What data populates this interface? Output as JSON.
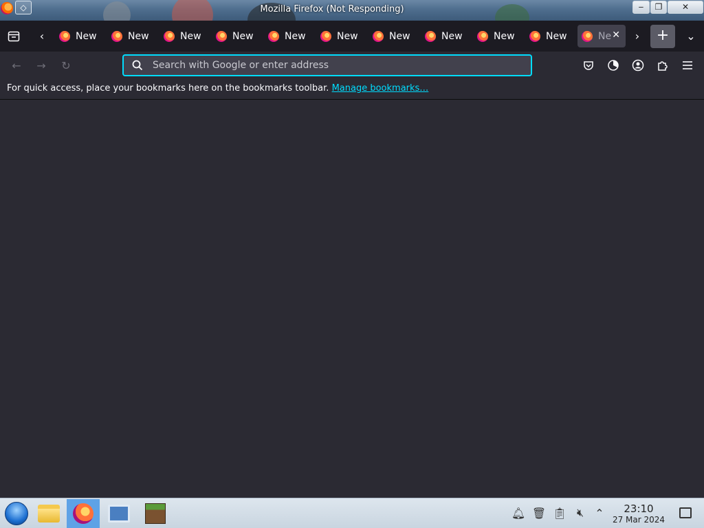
{
  "window": {
    "title": "Mozilla Firefox (Not Responding)",
    "controls": {
      "minimize": "‒",
      "maximize": "❐",
      "close": "✕"
    }
  },
  "tabs": {
    "items": [
      {
        "label": "New"
      },
      {
        "label": "New"
      },
      {
        "label": "New"
      },
      {
        "label": "New"
      },
      {
        "label": "New"
      },
      {
        "label": "New"
      },
      {
        "label": "New"
      },
      {
        "label": "New"
      },
      {
        "label": "New"
      },
      {
        "label": "New"
      }
    ],
    "active": {
      "label": "Ne"
    },
    "new_tab_glyph": "+"
  },
  "navbar": {
    "url_placeholder": "Search with Google or enter address"
  },
  "bookmarks": {
    "message": "For quick access, place your bookmarks here on the bookmarks toolbar.",
    "manage_link": "Manage bookmarks…"
  },
  "taskbar": {
    "pinned": [
      "start-orb",
      "file-manager",
      "firefox",
      "system-settings",
      "minecraft"
    ],
    "active_app": "firefox",
    "clock": {
      "time": "23:10",
      "date": "27 Mar 2024"
    }
  },
  "colors": {
    "tab_strip_bg": "#1c1b22",
    "toolbar_bg": "#2b2a33",
    "urlbar_bg": "#42414d",
    "focus_accent": "#00ddff",
    "taskbar_active": "#5ea2e6"
  }
}
